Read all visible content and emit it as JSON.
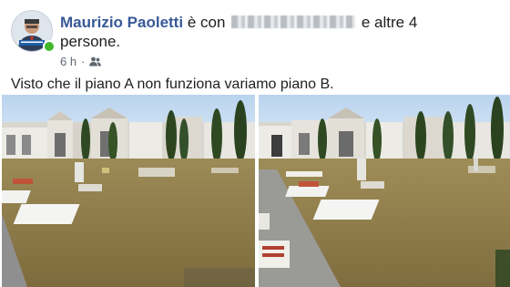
{
  "post": {
    "author": "Maurizio Paoletti",
    "with_prefix": "è con",
    "with_suffix": "e altre 4",
    "with_suffix_line2": "persone.",
    "time": "6 h",
    "separator": "·",
    "audience_icon": "friends-icon",
    "text": "Visto che il piano A non funziona variamo piano B."
  },
  "colors": {
    "author": "#385898",
    "text": "#1c1e21",
    "meta": "#606770",
    "online": "#42b72a",
    "sky": "#cfe1f3"
  },
  "photos": [
    {
      "name": "cemetery-photo-left"
    },
    {
      "name": "cemetery-photo-right"
    }
  ]
}
